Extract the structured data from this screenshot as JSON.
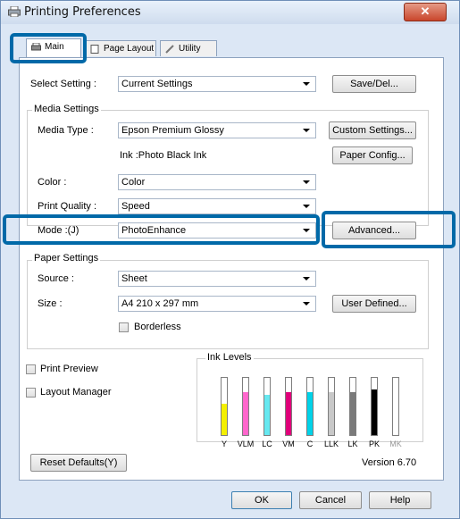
{
  "window": {
    "title": "Printing Preferences",
    "close_label": "✕"
  },
  "tabs": [
    {
      "label": "Main"
    },
    {
      "label": "Page Layout"
    },
    {
      "label": "Utility"
    }
  ],
  "select_setting": {
    "label": "Select Setting :",
    "value": "Current Settings",
    "save_button": "Save/Del..."
  },
  "media": {
    "group_title": "Media Settings",
    "type_label": "Media Type :",
    "type_value": "Epson Premium Glossy",
    "custom_button": "Custom Settings...",
    "ink_text": "Ink :Photo Black Ink",
    "paper_config_button": "Paper Config..."
  },
  "color": {
    "label": "Color :",
    "value": "Color"
  },
  "quality": {
    "label": "Print Quality :",
    "value": "Speed"
  },
  "mode": {
    "label": "Mode :(J)",
    "value": "PhotoEnhance",
    "advanced_button": "Advanced..."
  },
  "paper": {
    "group_title": "Paper Settings",
    "source_label": "Source :",
    "source_value": "Sheet",
    "size_label": "Size :",
    "size_value": "A4 210 x 297 mm",
    "user_defined_button": "User Defined...",
    "borderless_label": "Borderless"
  },
  "options": {
    "print_preview": "Print Preview",
    "layout_manager": "Layout Manager"
  },
  "ink_levels": {
    "title": "Ink Levels",
    "inks": [
      {
        "name": "Y",
        "color": "#f4f000",
        "level": 0.55
      },
      {
        "name": "VLM",
        "color": "#ff66cc",
        "level": 0.75
      },
      {
        "name": "LC",
        "color": "#66e8f0",
        "level": 0.7
      },
      {
        "name": "VM",
        "color": "#e0007a",
        "level": 0.75
      },
      {
        "name": "C",
        "color": "#00d2e8",
        "level": 0.75
      },
      {
        "name": "LLK",
        "color": "#c8c8c8",
        "level": 0.75
      },
      {
        "name": "LK",
        "color": "#7a7a7a",
        "level": 0.75
      },
      {
        "name": "PK",
        "color": "#000000",
        "level": 0.8
      },
      {
        "name": "MK",
        "color": "#ffffff",
        "level": 0.0
      }
    ]
  },
  "footer": {
    "reset_button": "Reset Defaults(Y)",
    "version": "Version 6.70"
  },
  "dialog_buttons": {
    "ok": "OK",
    "cancel": "Cancel",
    "help": "Help"
  }
}
